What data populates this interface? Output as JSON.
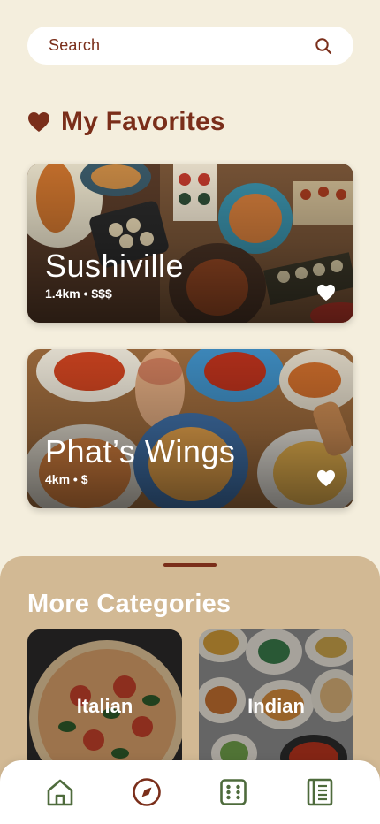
{
  "search": {
    "placeholder": "Search",
    "icon": "search-icon"
  },
  "favorites": {
    "title": "My Favorites",
    "icon": "heart-icon",
    "items": [
      {
        "name": "Sushiville",
        "meta": "1.4km • $$$",
        "favorited": true
      },
      {
        "name": "Phat’s Wings",
        "meta": "4km • $",
        "favorited": true
      }
    ]
  },
  "categories": {
    "title": "More Categories",
    "items": [
      {
        "label": "Italian"
      },
      {
        "label": "Indian"
      }
    ]
  },
  "tabbar": {
    "items": [
      {
        "icon": "home-icon"
      },
      {
        "icon": "compass-icon"
      },
      {
        "icon": "dice-icon"
      },
      {
        "icon": "notebook-icon"
      }
    ]
  },
  "colors": {
    "background": "#F4EEDD",
    "accent": "#7A2E1A",
    "sheet": "#D2B994",
    "tab_icon_home": "#4E6B3C",
    "tab_icon_compass": "#7A2E1A"
  }
}
